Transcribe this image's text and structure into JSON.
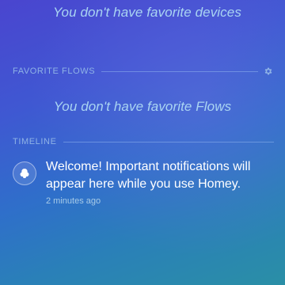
{
  "favorite_devices": {
    "empty_message": "You don't have favorite devices"
  },
  "favorite_flows": {
    "title": "FAVORITE FLOWS",
    "empty_message": "You don't have favorite Flows",
    "settings_icon": "gear-icon"
  },
  "timeline": {
    "title": "TIMELINE",
    "items": [
      {
        "icon": "homey-icon",
        "message": "Welcome! Important notifications will appear here while you use Homey.",
        "time": "2 minutes ago"
      }
    ]
  },
  "colors": {
    "accent_text": "#a9d4f2",
    "section_text": "#8fb3e6",
    "bg_top": "#4a45cf",
    "bg_bottom": "#2a8fa6"
  }
}
